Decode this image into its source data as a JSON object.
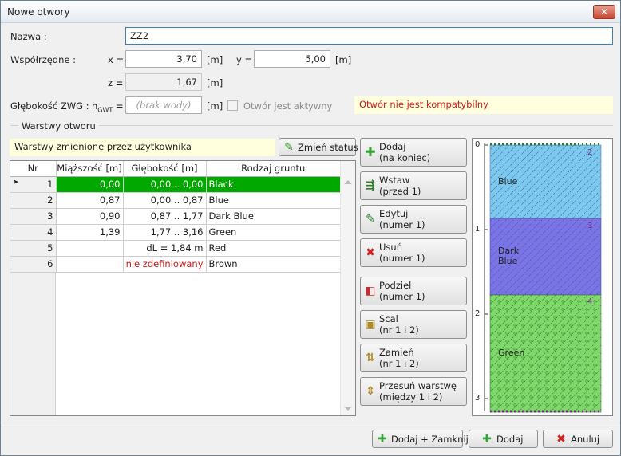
{
  "window": {
    "title": "Nowe otwory",
    "close": "✕"
  },
  "form": {
    "nazwa_label": "Nazwa :",
    "nazwa_value": "ZZ2",
    "wsp_label": "Współrzędne :",
    "x_label": "x =",
    "x_value": "3,70",
    "x_unit": "[m]",
    "y_label": "y =",
    "y_value": "5,00",
    "y_unit": "[m]",
    "z_label": "z =",
    "z_value": "1,67",
    "z_unit": "[m]",
    "gw_label": "Głębokość ZWG :",
    "hgwt_label": "h",
    "hgwt_sub": "GWT",
    "hgwt_eq": " =",
    "hgwt_placeholder": "(brak wody)",
    "hgwt_unit": "[m]",
    "active_label": "Otwór jest aktywny",
    "warning": "Otwór nie jest kompatybilny"
  },
  "layers": {
    "group_label": "Warstwy otworu",
    "changed_info": "Warstwy zmienione przez użytkownika",
    "change_status": "Zmień status",
    "columns": [
      "Nr",
      "Miąższość [m]",
      "Głębokość [m]",
      "Rodzaj gruntu"
    ],
    "rows": [
      {
        "nr": "1",
        "thick": "0,00",
        "depth": "0,00 .. 0,00",
        "soil": "Black"
      },
      {
        "nr": "2",
        "thick": "0,87",
        "depth": "0,00 .. 0,87",
        "soil": "Blue"
      },
      {
        "nr": "3",
        "thick": "0,90",
        "depth": "0,87 .. 1,77",
        "soil": "Dark Blue"
      },
      {
        "nr": "4",
        "thick": "1,39",
        "depth": "1,77 .. 3,16",
        "soil": "Green"
      },
      {
        "nr": "5",
        "thick": "",
        "depth": "dL = 1,84 m",
        "soil": "Red"
      },
      {
        "nr": "6",
        "thick": "",
        "depth": "nie zdefiniowany",
        "soil": "Brown"
      }
    ]
  },
  "actions": {
    "add": "Dodaj\n(na koniec)",
    "insert": "Wstaw\n(przed 1)",
    "edit": "Edytuj\n(numer 1)",
    "remove": "Usuń\n(numer 1)",
    "split": "Podziel\n(numer 1)",
    "merge": "Scal\n(nr 1 i 2)",
    "swap": "Zamień\n(nr 1 i 2)",
    "move": "Przesuń warstwę\n(między 1 i 2)"
  },
  "profile": {
    "axis": [
      "0",
      "1",
      "2",
      "3"
    ],
    "layers": [
      {
        "nr": "2",
        "name": "Blue",
        "color": "#7cc8ee"
      },
      {
        "nr": "3",
        "name": "Dark\nBlue",
        "color": "#7b74e6"
      },
      {
        "nr": "4",
        "name": "Green",
        "color": "#7ed86a"
      }
    ]
  },
  "footer": {
    "add_close": "Dodaj + Zamknij",
    "add": "Dodaj",
    "cancel": "Anuluj"
  },
  "colors": {
    "selected_row": "#00a800",
    "warning_text": "#d01a1a",
    "info_bg": "#ffffde"
  }
}
